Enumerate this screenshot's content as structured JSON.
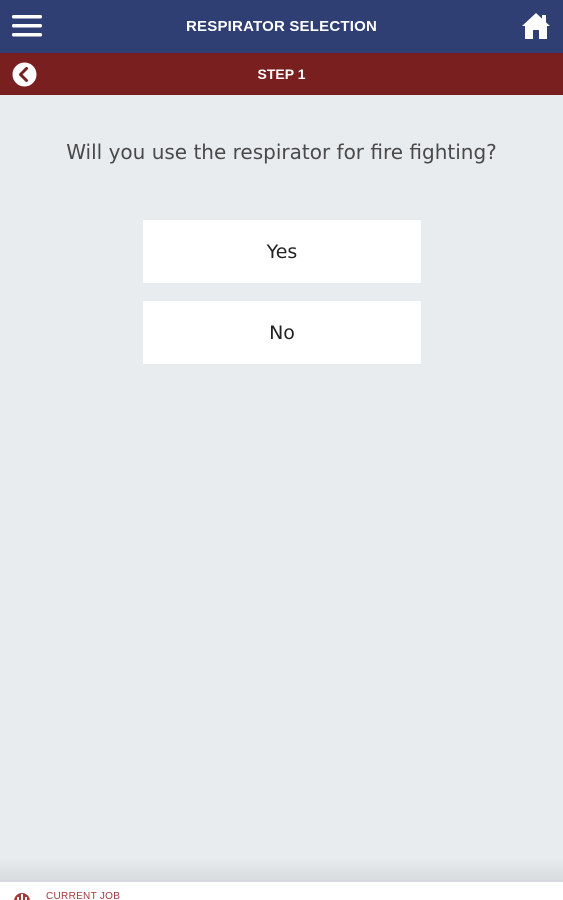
{
  "header": {
    "title": "RESPIRATOR SELECTION",
    "menu_icon": "hamburger-menu-icon",
    "home_icon": "home-icon"
  },
  "step_bar": {
    "title": "STEP 1",
    "back_icon": "chevron-left-circle-icon"
  },
  "question": {
    "text": "Will you use the respirator for fire fighting?"
  },
  "answers": [
    {
      "label": "Yes"
    },
    {
      "label": "No"
    }
  ],
  "footer": {
    "current_job_label": "CURRENT JOB",
    "current_job_icon": "job-icon"
  },
  "colors": {
    "header_bg": "#2f3e73",
    "step_bar_bg": "#7a1f1f",
    "page_bg": "#e9ecef",
    "footer_accent": "#a23a3a"
  }
}
